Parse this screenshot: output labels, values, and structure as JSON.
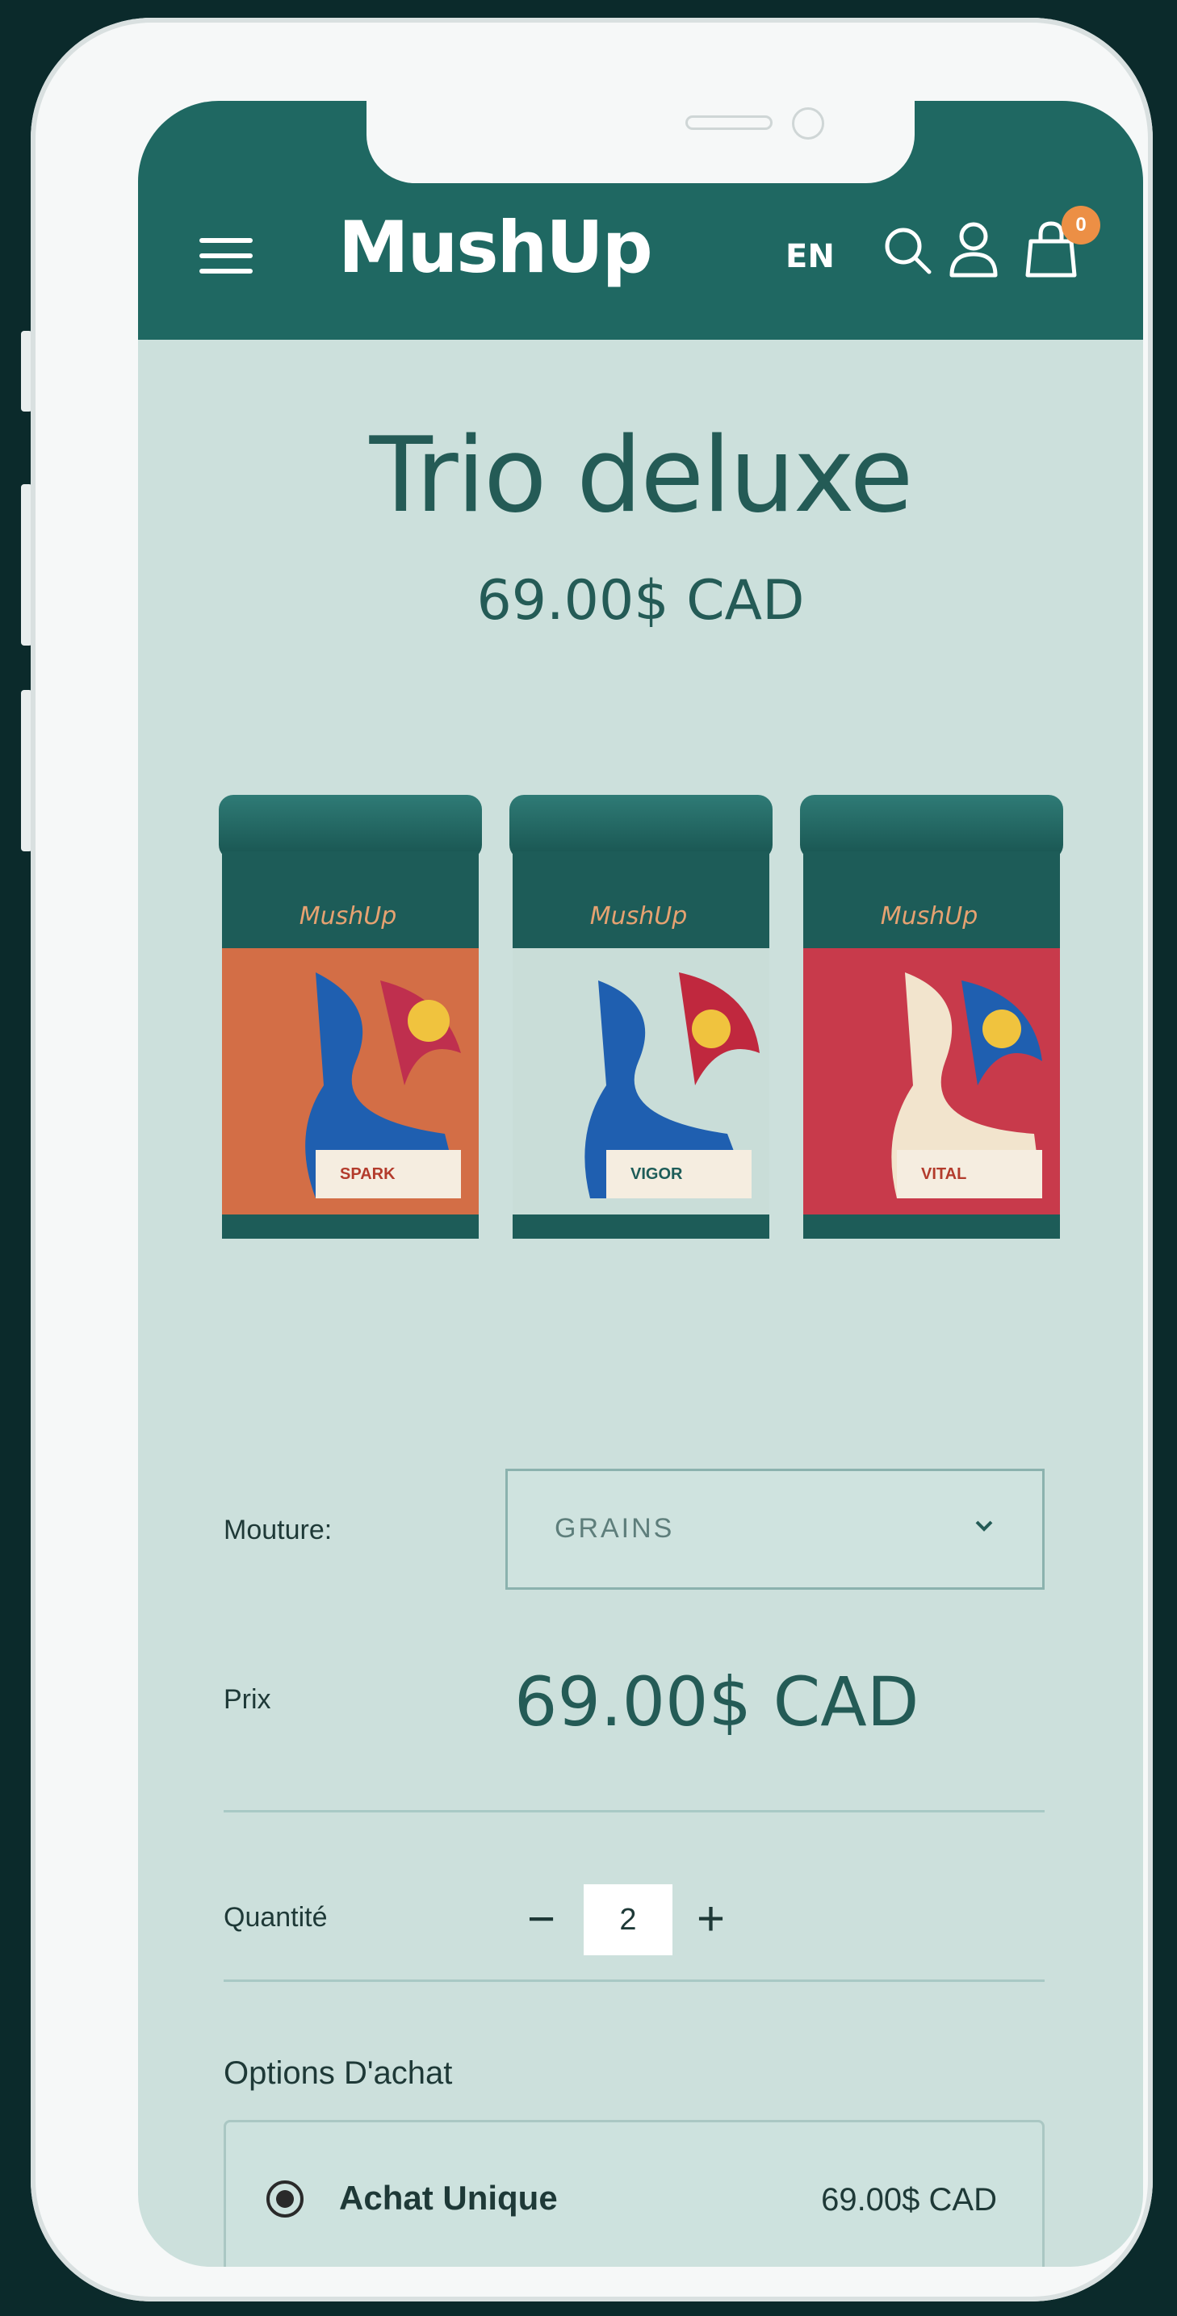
{
  "header": {
    "logo": "MushUp",
    "language": "EN",
    "cart_count": "0"
  },
  "product": {
    "title": "Trio deluxe",
    "price": "69.00$ CAD",
    "cans": [
      {
        "brand": "MushUp",
        "name": "SPARK",
        "color": "#d36e46"
      },
      {
        "brand": "MushUp",
        "name": "VIGOR",
        "color": "#c9ddd8"
      },
      {
        "brand": "MushUp",
        "name": "VITAL",
        "color": "#c83a4b"
      }
    ]
  },
  "form": {
    "grind_label": "Mouture:",
    "grind_value": "GRAINS",
    "price_label": "Prix",
    "price_value": "69.00$ CAD",
    "quantity_label": "Quantité",
    "quantity_value": "2",
    "quantity_minus": "−",
    "quantity_plus": "+",
    "options_title": "Options D'achat",
    "option": {
      "label": "Achat Unique",
      "price": "69.00$ CAD",
      "selected": true
    }
  },
  "colors": {
    "header": "#1f6862",
    "background": "#cce0dc",
    "accent_badge": "#ec8f45",
    "text_primary": "#245b56"
  }
}
